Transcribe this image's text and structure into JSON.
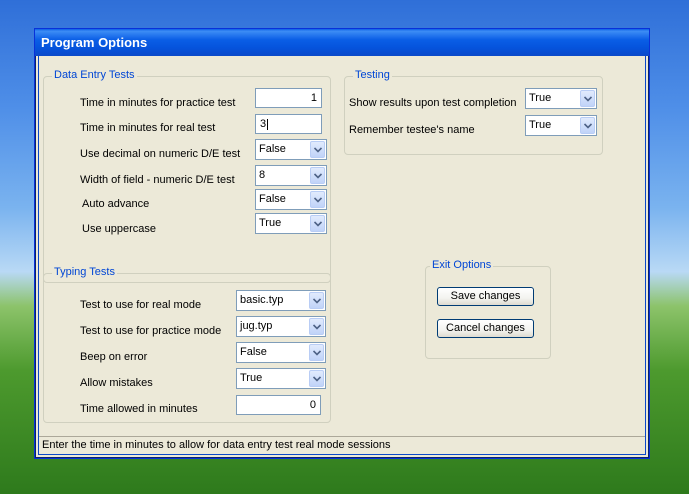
{
  "window": {
    "title": "Program Options"
  },
  "data_entry": {
    "group_label": "Data Entry Tests",
    "practice_label": "Time in minutes for practice test",
    "practice_value": "1",
    "real_label": "Time in minutes for real test",
    "real_value": "3",
    "decimal_label": "Use decimal on numeric D/E test",
    "decimal_value": "False",
    "width_label": "Width of field - numeric D/E test",
    "width_value": "8",
    "auto_label": "Auto advance",
    "auto_value": "False",
    "upper_label": "Use uppercase",
    "upper_value": "True"
  },
  "testing": {
    "group_label": "Testing",
    "show_label": "Show results upon test completion",
    "show_value": "True",
    "remember_label": "Remember testee's name",
    "remember_value": "True"
  },
  "typing": {
    "group_label": "Typing Tests",
    "real_label": "Test to use for real mode",
    "real_value": "basic.typ",
    "practice_label": "Test to use for practice mode",
    "practice_value": "jug.typ",
    "beep_label": "Beep on error",
    "beep_value": "False",
    "mistakes_label": "Allow mistakes",
    "mistakes_value": "True",
    "time_label": "Time allowed in minutes",
    "time_value": "0"
  },
  "exit": {
    "group_label": "Exit Options",
    "save_label": "Save changes",
    "cancel_label": "Cancel changes"
  },
  "status": {
    "text": "Enter the time in minutes to allow for data entry test real mode sessions"
  },
  "icons": {
    "dropdown": "chevron-down-icon"
  },
  "colors": {
    "title_bar": "#0a5ee6",
    "group_label": "#0046d5",
    "dialog_bg": "#ece9d8"
  }
}
